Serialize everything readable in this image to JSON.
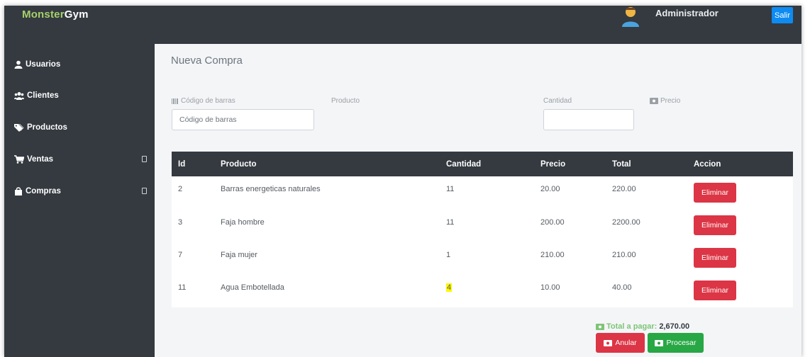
{
  "app": {
    "brand_part1": "Monster",
    "brand_part2": "Gym"
  },
  "header": {
    "user_name": "Administrador",
    "exit_label": "Salir"
  },
  "sidebar": {
    "items": [
      {
        "label": "Usuarios",
        "icon": "user-icon",
        "has_caret": false
      },
      {
        "label": "Clientes",
        "icon": "users-icon",
        "has_caret": false
      },
      {
        "label": "Productos",
        "icon": "tags-icon",
        "has_caret": false
      },
      {
        "label": "Ventas",
        "icon": "cart-icon",
        "has_caret": true
      },
      {
        "label": "Compras",
        "icon": "bag-icon",
        "has_caret": true
      }
    ]
  },
  "page": {
    "title": "Nueva Compra"
  },
  "form": {
    "barcode_label": "Código de barras",
    "barcode_placeholder": "Código de barras",
    "product_label": "Producto",
    "quantity_label": "Cantidad",
    "quantity_value": "",
    "price_label": "Precio"
  },
  "table": {
    "columns": [
      "Id",
      "Producto",
      "Cantidad",
      "Precio",
      "Total",
      "Accion"
    ],
    "rows": [
      {
        "id": "2",
        "producto": "Barras energeticas naturales",
        "cantidad": "11",
        "precio": "20.00",
        "total": "220.00",
        "accion": "Eliminar"
      },
      {
        "id": "3",
        "producto": "Faja hombre",
        "cantidad": "11",
        "precio": "200.00",
        "total": "2200.00",
        "accion": "Eliminar"
      },
      {
        "id": "7",
        "producto": "Faja mujer",
        "cantidad": "1",
        "precio": "210.00",
        "total": "210.00",
        "accion": "Eliminar"
      },
      {
        "id": "11",
        "producto": "Agua Embotellada",
        "cantidad": "4",
        "precio": "10.00",
        "total": "40.00",
        "accion": "Eliminar"
      }
    ]
  },
  "summary": {
    "total_label": "Total a pagar:",
    "total_value": "2,670.00",
    "cancel_label": "Anular",
    "process_label": "Procesar"
  },
  "colors": {
    "sidebar_bg": "#343a40",
    "brand_accent": "#a6d16b",
    "danger": "#dc3545",
    "success": "#28a745",
    "primary": "#0d8bf2"
  }
}
